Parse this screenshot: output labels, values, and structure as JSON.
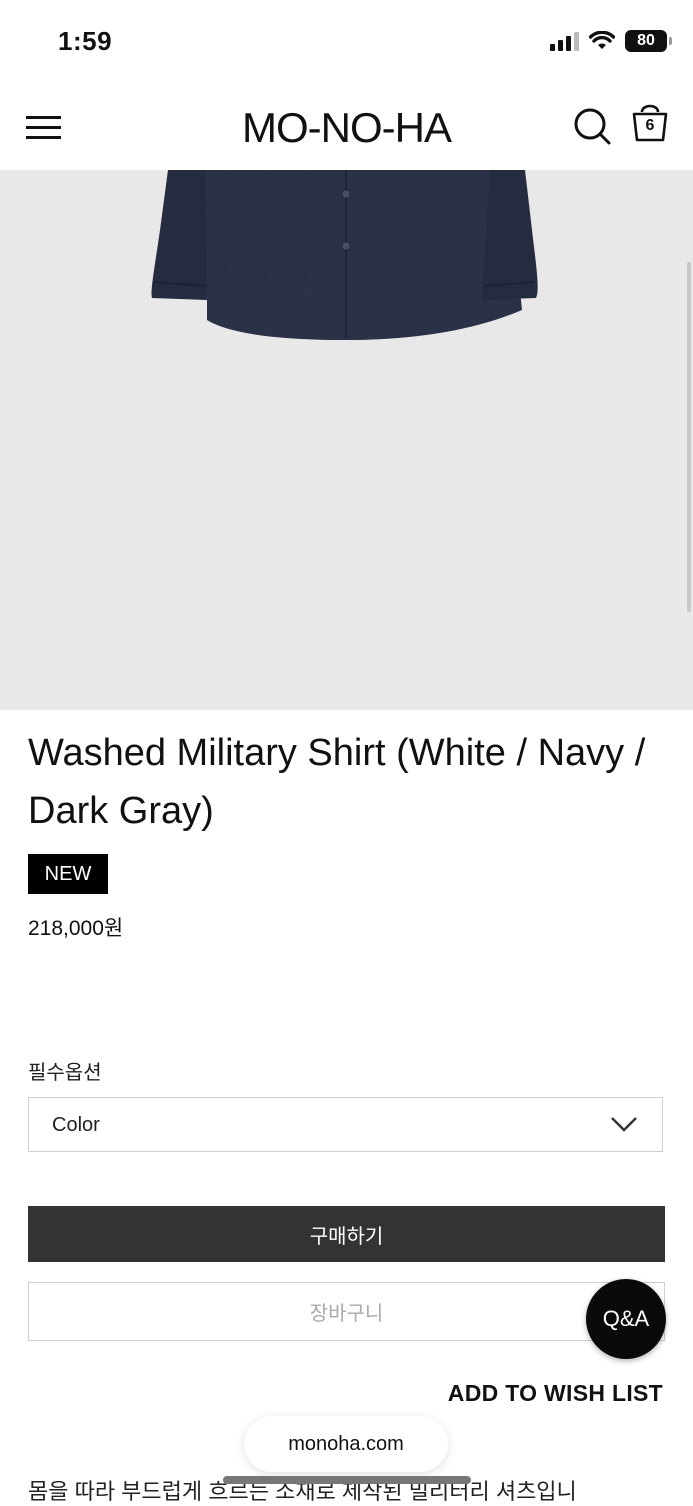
{
  "status_bar": {
    "time": "1:59",
    "battery": "80"
  },
  "header": {
    "logo": "MO-NO-HA",
    "cart_count": "6"
  },
  "product": {
    "title": "Washed Military Shirt (White / Navy / Dark Gray)",
    "badge": "NEW",
    "price": "218,000원",
    "shirt_color": "#2b3146",
    "description_preview": "몸을 따라 부드럽게 흐르는 소재로 제작된 밀리터리 셔츠입니"
  },
  "options": {
    "label": "필수옵션",
    "select_value": "Color"
  },
  "actions": {
    "buy": "구매하기",
    "cart": "장바구니",
    "wishlist": "ADD TO WISH LIST",
    "qa": "Q&A"
  },
  "browser": {
    "url": "monoha.com"
  },
  "colors": {
    "accent_dark": "#333333",
    "image_bg": "#e8e8e8"
  }
}
